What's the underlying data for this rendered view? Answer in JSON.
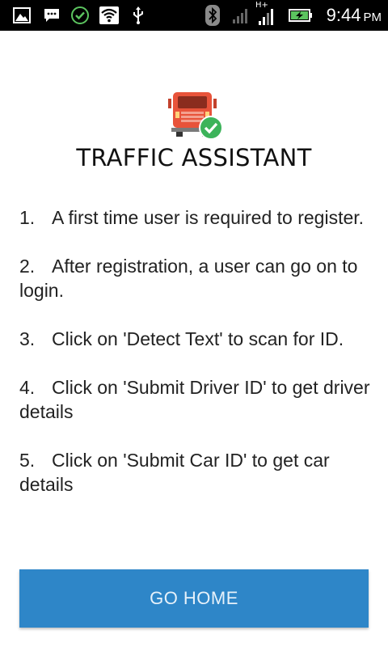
{
  "status_bar": {
    "network_type": "H+",
    "time": "9:44",
    "ampm": "PM",
    "icons": [
      "gallery-icon",
      "message-icon",
      "check-circle-icon",
      "wifi-icon",
      "usb-icon",
      "bluetooth-icon",
      "signal-icon",
      "signal-icon",
      "battery-charging-icon"
    ],
    "colors": {
      "background": "#000000",
      "icon": "#ffffff",
      "check": "#5cc45f",
      "battery": "#5cc45f"
    }
  },
  "app": {
    "logo_icon": "truck-check-icon",
    "title": "TRAFFIC ASSISTANT",
    "instructions": [
      {
        "number": "1.",
        "text": "A first time user is required to register."
      },
      {
        "number": "2.",
        "text": "After registration, a user can go on to login."
      },
      {
        "number": "3.",
        "text": "Click on 'Detect Text' to scan for ID."
      },
      {
        "number": "4.",
        "text": "Click on 'Submit Driver ID' to get driver details"
      },
      {
        "number": "5.",
        "text": "Click on 'Submit Car ID' to get car details"
      }
    ],
    "go_home_label": "GO HOME",
    "colors": {
      "button": "#2e86c8",
      "truck": "#e8533a",
      "check_badge": "#3cb35a"
    }
  }
}
